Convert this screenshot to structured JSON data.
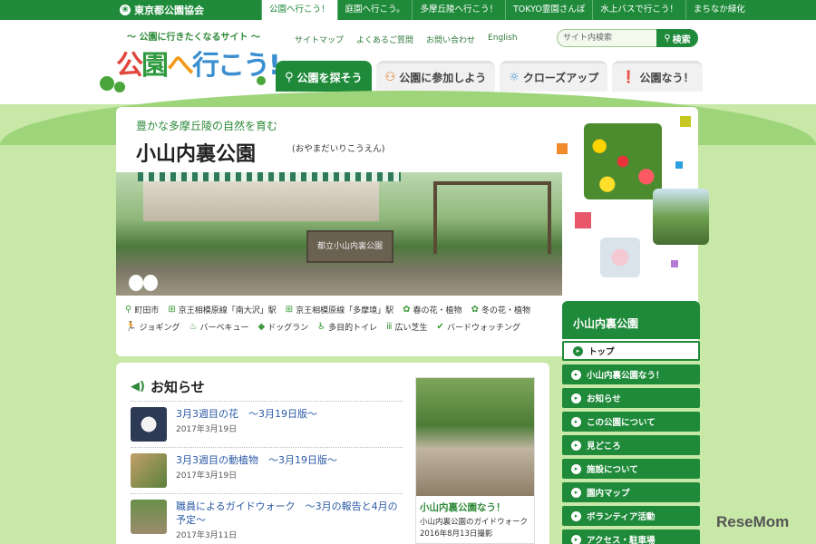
{
  "topbar": {
    "org": "東京都公園協会",
    "nav": [
      "公園へ行こう！",
      "庭園へ行こう。",
      "多摩丘陵へ行こう！",
      "TOKYO霊園さんぽ",
      "水上バスで行こう！",
      "まちなか緑化"
    ]
  },
  "header": {
    "tagline": "〜 公園に行きたくなるサイト 〜",
    "logo": [
      "公",
      "園",
      "へ",
      "行こう!"
    ],
    "utility": [
      "サイトマップ",
      "よくあるご質問",
      "お問い合わせ",
      "English"
    ],
    "search_placeholder": "サイト内検索",
    "search_button": "検索",
    "tabs": [
      "公園を探そう",
      "公園に参加しよう",
      "クローズアップ",
      "公園なう！"
    ]
  },
  "park": {
    "subtitle": "豊かな多摩丘陵の自然を育む",
    "title": "小山内裏公園",
    "reading": "(おやまだいりこうえん)",
    "sign_text": "都立小山内裏公園",
    "info_row1": [
      "町田市",
      "京王相模原線「南大沢」駅",
      "京王相模原線「多摩境」駅",
      "春の花・植物",
      "冬の花・植物"
    ],
    "info_row2": [
      "ジョギング",
      "バーベキュー",
      "ドッグラン",
      "多目的トイレ",
      "広い芝生",
      "バードウォッチング"
    ]
  },
  "sidemenu": {
    "title": "小山内裏公園",
    "items": [
      "トップ",
      "小山内裏公園なう！",
      "お知らせ",
      "この公園について",
      "見どころ",
      "施設について",
      "園内マップ",
      "ボランティア活動",
      "アクセス・駐車場"
    ]
  },
  "news": {
    "title": "お知らせ",
    "items": [
      {
        "headline": "3月3週目の花　〜3月19日版〜",
        "date": "2017年3月19日"
      },
      {
        "headline": "3月3週目の動植物　〜3月19日版〜",
        "date": "2017年3月19日"
      },
      {
        "headline": "職員によるガイドウォーク　〜3月の報告と4月の予定〜",
        "date": "2017年3月11日"
      }
    ],
    "promo": {
      "title": "小山内裏公園なう！",
      "desc": "小山内裏公園のガイドウォーク",
      "date": "2016年8月13日撮影"
    }
  },
  "watermark": "ReseMom",
  "colors": {
    "brand_green": "#1f8a3a",
    "link_blue": "#2b5aa5"
  }
}
